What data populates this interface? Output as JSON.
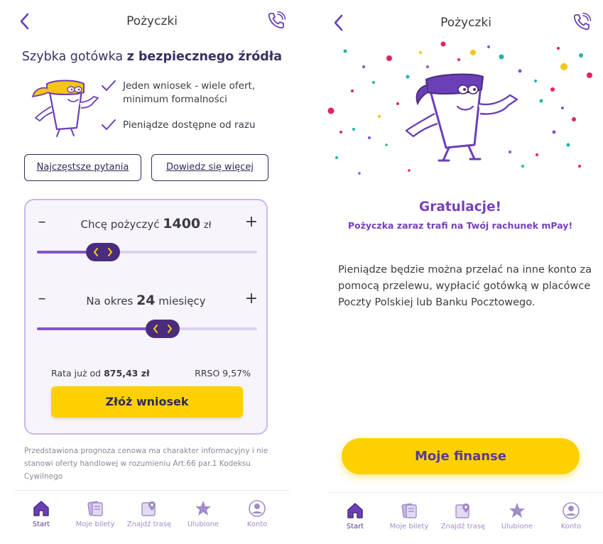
{
  "colors": {
    "brand_purple": "#7740bd",
    "dark_purple": "#4a2c7c",
    "accent_yellow": "#ffd000",
    "card_border": "#c9b8e8"
  },
  "left": {
    "header": {
      "title": "Pożyczki",
      "back_icon": "chevron-left-icon",
      "phone_icon": "phone-icon"
    },
    "tagline": {
      "prefix": "Szybka gotówka",
      "bold": "z bezpiecznego źródła"
    },
    "features": [
      {
        "text": "Jeden wniosek - wiele ofert, minimum formalności"
      },
      {
        "text": "Pieniądze dostępne od razu"
      }
    ],
    "buttons": {
      "faq": "Najczęstsze pytania",
      "more": "Dowiedz się więcej"
    },
    "amount": {
      "prefix": "Chcę pożyczyć",
      "value": "1400",
      "unit": "zł",
      "slider_level": 0.3
    },
    "period": {
      "prefix": "Na okres",
      "value": "24",
      "unit": "miesięcy",
      "slider_level": 0.57
    },
    "rate": {
      "prefix": "Rata już od",
      "value": "875,43 zł",
      "rrso": "RRSO 9,57%"
    },
    "submit": "Złóż wniosek",
    "disclaimer": "Przedstawiona prognoza cenowa ma charakter informacyjny i nie stanowi oferty handlowej w rozumieniu Art.66 par.1 Kodeksu Cywilnego"
  },
  "right": {
    "header": {
      "title": "Pożyczki",
      "back_icon": "chevron-left-icon",
      "phone_icon": "phone-icon"
    },
    "congrats": "Gratulacje!",
    "subtitle": "Pożyczka zaraz trafi na Twój rachunek mPay!",
    "body": "Pieniądze będzie można przelać na inne konto za pomocą przelewu, wypłacić gotówką w placówce Poczty Polskiej lub Banku Pocztowego.",
    "cta": "Moje finanse"
  },
  "nav": [
    {
      "label": "Start",
      "icon": "home-icon",
      "active": true
    },
    {
      "label": "Moje bilety",
      "icon": "tickets-icon",
      "active": false
    },
    {
      "label": "Znajdź trasę",
      "icon": "map-pin-icon",
      "active": false
    },
    {
      "label": "Ulubione",
      "icon": "star-icon",
      "active": false
    },
    {
      "label": "Konto",
      "icon": "account-icon",
      "active": false
    }
  ]
}
